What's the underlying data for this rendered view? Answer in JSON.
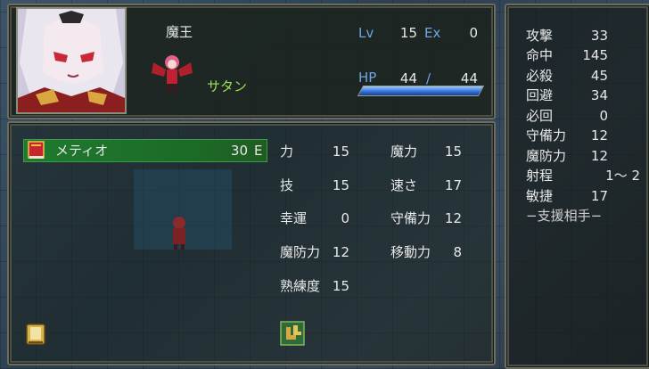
{
  "unit": {
    "class_name": "魔王",
    "name": "サタン",
    "lv_label": "Lv",
    "lv": "15",
    "ex_label": "Ex",
    "ex": "0",
    "hp_label": "HP",
    "hp_current": "44",
    "hp_sep": "/",
    "hp_max": "44",
    "hp_fraction": 1.0
  },
  "weapon": {
    "name": "メティオ",
    "uses": "30",
    "rank": "E"
  },
  "stats": [
    {
      "label": "力",
      "value": "15"
    },
    {
      "label": "魔力",
      "value": "15"
    },
    {
      "label": "技",
      "value": "15"
    },
    {
      "label": "速さ",
      "value": "17"
    },
    {
      "label": "幸運",
      "value": "0"
    },
    {
      "label": "守備力",
      "value": "12"
    },
    {
      "label": "魔防力",
      "value": "12"
    },
    {
      "label": "移動力",
      "value": "8"
    },
    {
      "label": "熟練度",
      "value": "15"
    }
  ],
  "combat": [
    {
      "label": "攻撃",
      "value": "33"
    },
    {
      "label": "命中",
      "value": "145"
    },
    {
      "label": "必殺",
      "value": "45"
    },
    {
      "label": "回避",
      "value": "34"
    },
    {
      "label": "必回",
      "value": "0"
    },
    {
      "label": "守備力",
      "value": "12"
    },
    {
      "label": "魔防力",
      "value": "12"
    },
    {
      "label": "射程",
      "value": "1～ 2"
    },
    {
      "label": "敏捷",
      "value": "17"
    }
  ],
  "support_title": "−支援相手−",
  "colors": {
    "label_blue": "#6fa5e6",
    "label_green": "#9be05a",
    "hp_fill": "#2f6bd6",
    "weapon_row": "#1f7a2e"
  },
  "icons": [
    "tome-icon",
    "item-book-icon",
    "skill-boots-icon",
    "sprite-icon",
    "portrait-image"
  ]
}
